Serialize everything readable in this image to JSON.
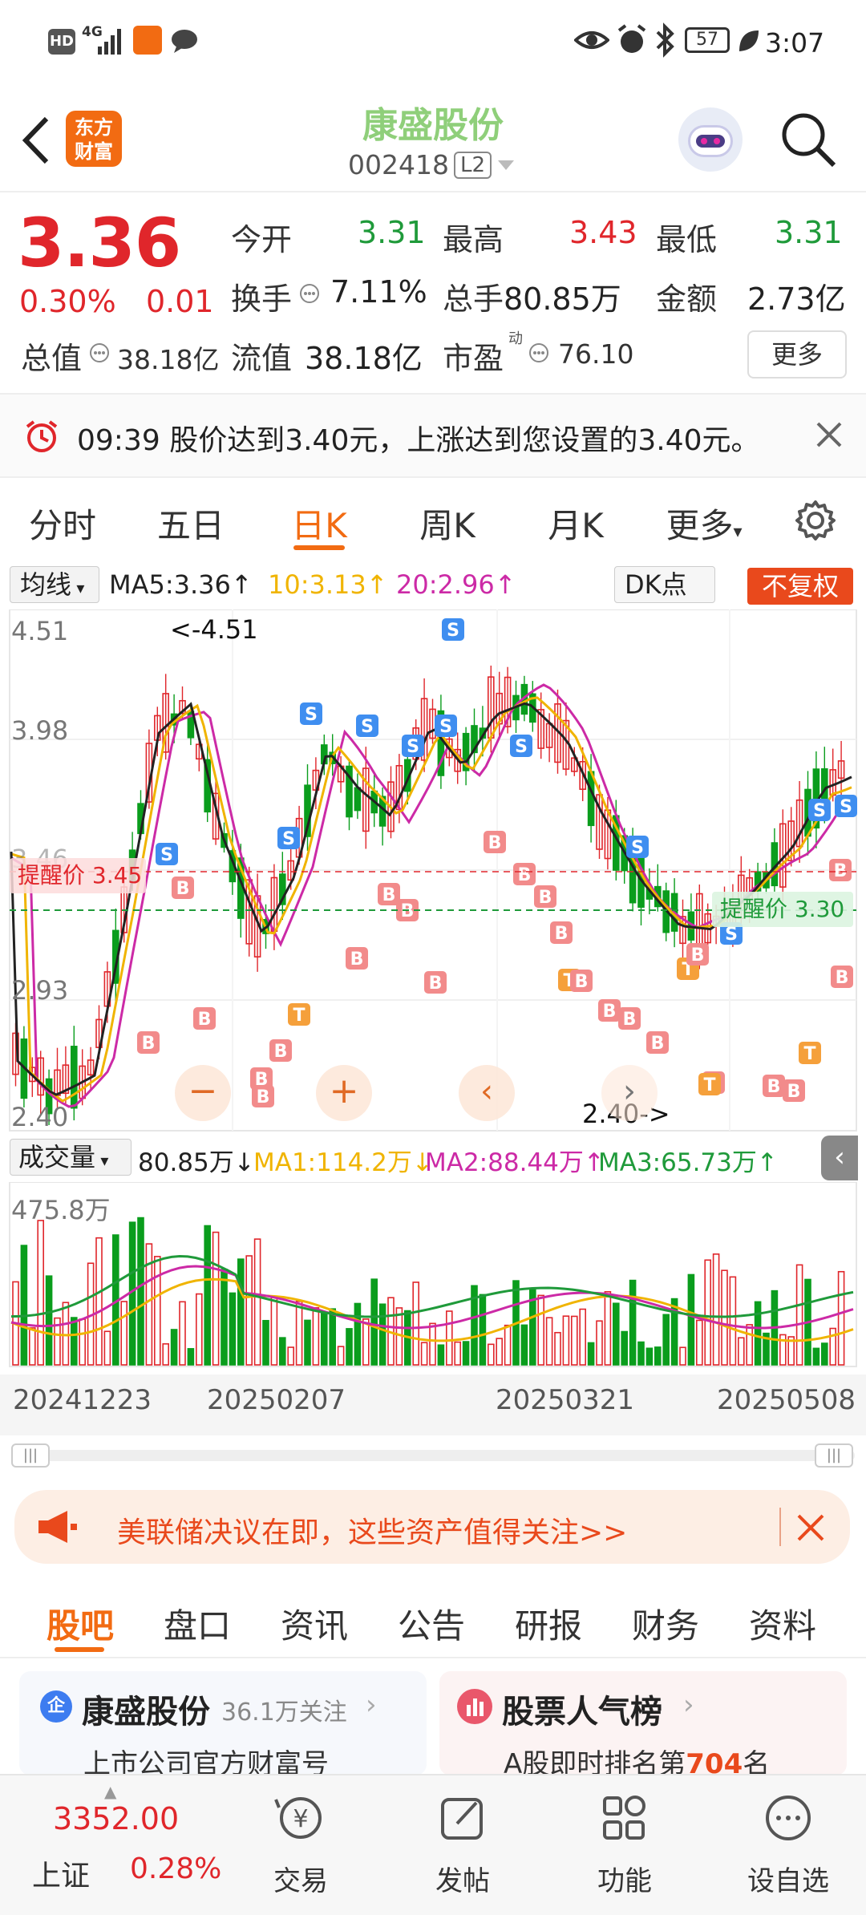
{
  "status_bar": {
    "time": "3:07",
    "battery": "57",
    "hd": "HD",
    "signal": "4G"
  },
  "header": {
    "back_icon": "chevron-left-icon",
    "logo_line1": "东方",
    "logo_line2": "财富",
    "title": "康盛股份",
    "code": "002418",
    "level": "L2",
    "search_icon": "search-icon"
  },
  "quote": {
    "price": "3.36",
    "change_pct": "0.30%",
    "change_amt": "0.01",
    "open_label": "今开",
    "open": "3.31",
    "high_label": "最高",
    "high": "3.43",
    "low_label": "最低",
    "low": "3.31",
    "turnover_label": "换手",
    "turnover": "7.11%",
    "volume_label": "总手",
    "volume": "80.85万",
    "amount_label": "金额",
    "amount": "2.73亿",
    "total_mv_label": "总值",
    "total_mv": "38.18亿",
    "float_mv_label": "流值",
    "float_mv": "38.18亿",
    "pe_label": "市盈",
    "pe_sup": "动",
    "pe": "76.10",
    "more_button": "更多"
  },
  "alert": {
    "text": "09:39 股价达到3.40元，上涨达到您设置的3.40元。"
  },
  "period_tabs": {
    "items": [
      "分时",
      "五日",
      "日K",
      "周K",
      "月K",
      "更多"
    ],
    "active": "日K"
  },
  "kline": {
    "indicator": "均线",
    "ma5": "MA5:3.36↑",
    "ma10": "10:3.13↑",
    "ma20": "20:2.96↑",
    "dk_button": "DK点",
    "adjust_button": "不复权",
    "y_labels": [
      "4.51",
      "3.98",
      "3.46",
      "2.93",
      "2.40"
    ],
    "max_label": "<-4.51",
    "min_label": "2.40->",
    "alert_left": "提醒价 3.45",
    "alert_right": "提醒价 3.30",
    "colors": {
      "ma5": "#222222",
      "ma10": "#f0b400",
      "ma20": "#cc2aa6",
      "up": "#e0262b",
      "down": "#0a9d1d"
    }
  },
  "volume": {
    "indicator": "成交量",
    "value": "80.85万↓",
    "ma1": "MA1:114.2万↓",
    "ma2": "MA2:88.44万↑",
    "ma3": "MA3:65.73万↑",
    "max_label": "475.8万",
    "dates": [
      "20241223",
      "20250207",
      "20250321",
      "20250508"
    ]
  },
  "news_banner": {
    "text": "美联储决议在即，这些资产值得关注>>"
  },
  "bottom_tabs": {
    "items": [
      "股吧",
      "盘口",
      "资讯",
      "公告",
      "研报",
      "财务",
      "资料"
    ],
    "active": "股吧"
  },
  "cards": {
    "left_title": "康盛股份",
    "left_follow": "36.1万关注",
    "left_sub": "上市公司官方财富号",
    "right_title": "股票人气榜",
    "right_sub_prefix": "A股即时排名第",
    "right_rank": "704",
    "right_sub_suffix": "名"
  },
  "bottom_nav": {
    "index_value": "3352.00",
    "index_name": "上证",
    "index_change": "0.28%",
    "items": [
      "交易",
      "发帖",
      "功能",
      "设自选"
    ]
  }
}
